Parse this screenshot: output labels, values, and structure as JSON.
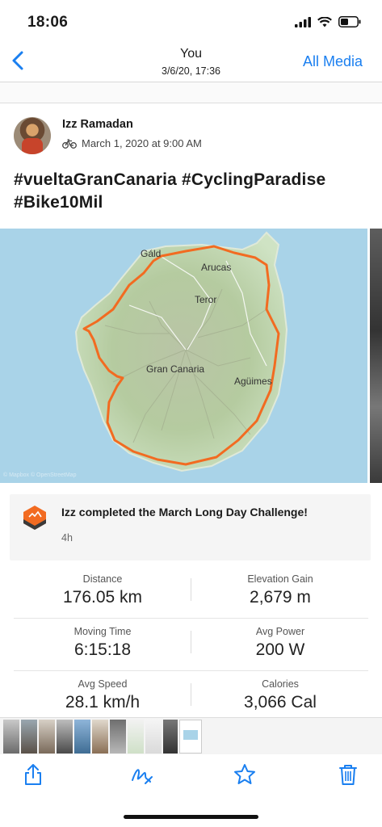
{
  "status_bar": {
    "time": "18:06"
  },
  "nav": {
    "back_icon": "chevron-left-icon",
    "title": "You",
    "subtitle": "3/6/20, 17:36",
    "right_action": "All Media"
  },
  "post": {
    "author": "Izz Ramadan",
    "activity_icon": "bicycle-icon",
    "date": "March 1, 2020 at 9:00 AM",
    "title": "#vueltaGranCanaria #CyclingParadise #Bike10Mil",
    "map": {
      "labels": [
        "Gáld",
        "Arucas",
        "Teror",
        "Gran Canaria",
        "Agüimes"
      ],
      "attribution": "© Mapbox © OpenStreetMap",
      "route_color": "#f26b21"
    },
    "challenge": {
      "text": "Izz completed the March Long Day Challenge!",
      "time": "4h"
    },
    "stats": [
      {
        "label": "Distance",
        "value": "176.05 km"
      },
      {
        "label": "Elevation Gain",
        "value": "2,679 m"
      },
      {
        "label": "Moving Time",
        "value": "6:15:18"
      },
      {
        "label": "Avg Power",
        "value": "200 W"
      },
      {
        "label": "Avg Speed",
        "value": "28.1 km/h"
      },
      {
        "label": "Calories",
        "value": "3,066 Cal"
      }
    ]
  },
  "toolbar": {
    "share_icon": "share-icon",
    "markup_icon": "markup-icon",
    "favorite_icon": "star-icon",
    "delete_icon": "trash-icon"
  },
  "colors": {
    "accent": "#1a7ff0",
    "strava_orange": "#f26b21"
  }
}
